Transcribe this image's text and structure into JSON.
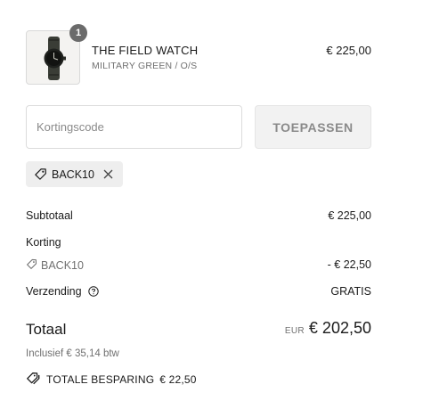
{
  "product": {
    "quantity": "1",
    "name": "THE FIELD WATCH",
    "variant": "MILITARY GREEN / O/S",
    "price": "€ 225,00",
    "image_icon": "wristwatch-image"
  },
  "discount": {
    "placeholder": "Kortingscode",
    "value": "",
    "apply_label": "TOEPASSEN",
    "applied_code": "BACK10",
    "remove_icon": "close-icon",
    "tag_icon": "tag-icon"
  },
  "totals": {
    "subtotal_label": "Subtotaal",
    "subtotal_value": "€ 225,00",
    "discount_heading": "Korting",
    "discount_code": "BACK10",
    "discount_value": "- € 22,50",
    "shipping_label": "Verzending",
    "shipping_value": "GRATIS",
    "shipping_info_icon": "question-circle-icon",
    "total_label": "Totaal",
    "total_currency": "EUR",
    "total_value": "€ 202,50",
    "tax_note": "Inclusief € 35,14 btw",
    "savings_label": "TOTALE BESPARING",
    "savings_value": "€ 22,50",
    "savings_icon": "double-tag-icon"
  },
  "colors": {
    "text": "#1a1a1a",
    "muted": "#707070",
    "badge": "#6b6b6b",
    "button_bg": "#f2f2f2",
    "chip_bg": "#eeeeee"
  }
}
